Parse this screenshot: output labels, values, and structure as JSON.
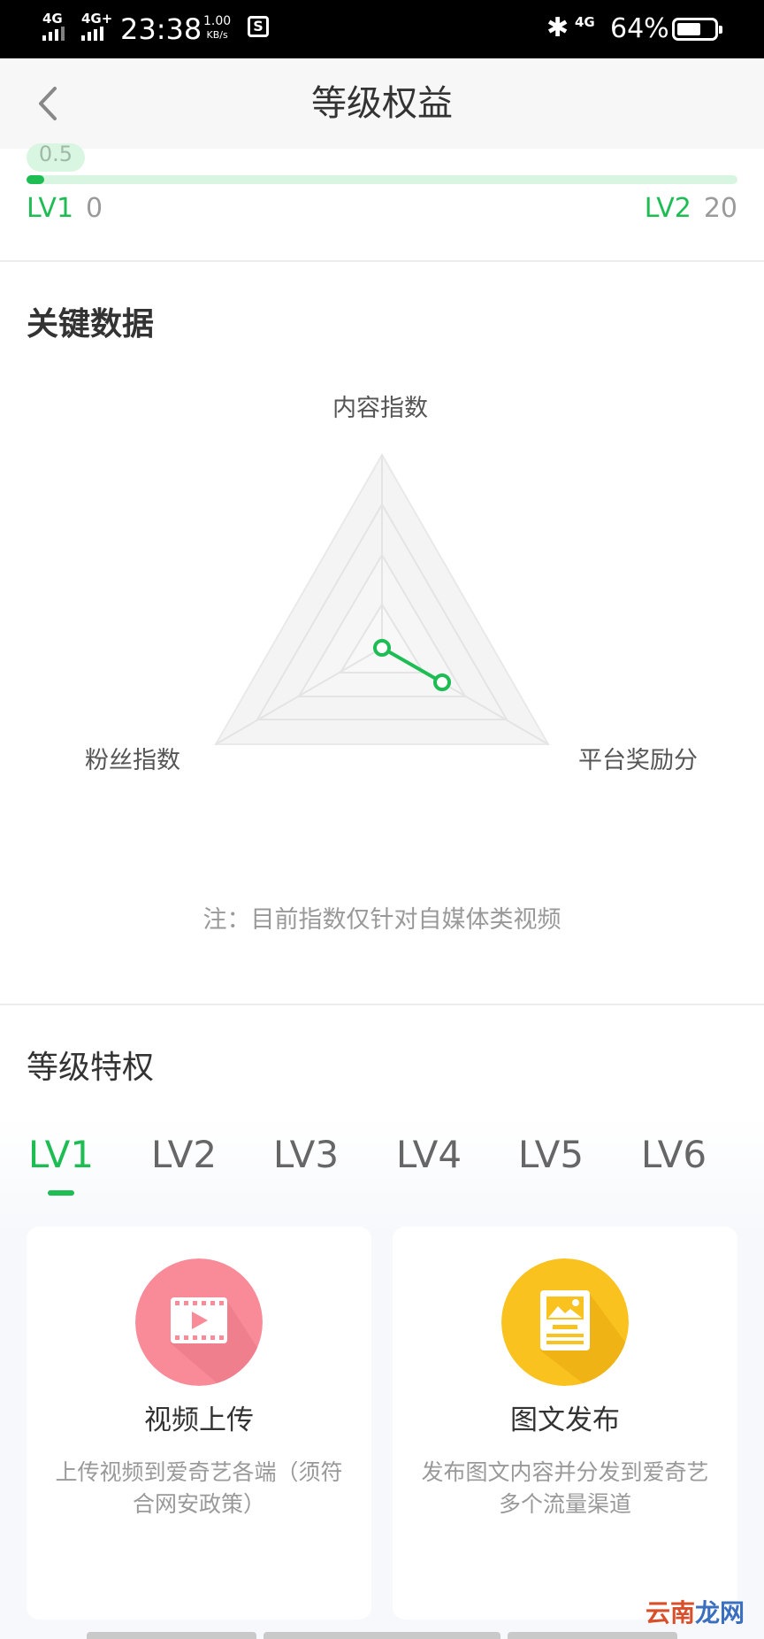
{
  "status_bar": {
    "network_1": "4G",
    "network_2": "4G+",
    "time": "23:38",
    "speed_value": "1.00",
    "speed_unit": "KB/s",
    "app_icon": "S",
    "bluetooth_icon": "bluetooth-icon",
    "network_3": "4G",
    "battery_percent": "64%",
    "battery_level": 0.64
  },
  "header": {
    "title": "等级权益",
    "back_icon": "chevron-left-icon"
  },
  "progress": {
    "bubble_value": "0.5",
    "current_level": "LV1",
    "current_value": "0",
    "next_level": "LV2",
    "next_value": "20",
    "fraction": 0.025,
    "colors": {
      "accent": "#1dbd54",
      "track": "#d7f5e0"
    }
  },
  "key_data": {
    "title": "关键数据",
    "radar_labels": {
      "top": "内容指数",
      "left": "粉丝指数",
      "right": "平台奖励分"
    },
    "note": "注：目前指数仅针对自媒体类视频"
  },
  "privileges": {
    "title": "等级特权",
    "tabs": [
      "LV1",
      "LV2",
      "LV3",
      "LV4",
      "LV5",
      "LV6"
    ],
    "active_tab": "LV1",
    "cards": [
      {
        "icon": "video-upload-icon",
        "title": "视频上传",
        "description": "上传视频到爱奇艺各端（须符合网安政策）",
        "color": "#f98b99"
      },
      {
        "icon": "article-publish-icon",
        "title": "图文发布",
        "description": "发布图文内容并分发到爱奇艺多个流量渠道",
        "color": "#f9c21f"
      }
    ]
  },
  "watermark": {
    "part1": "云南",
    "part2": "龙网"
  }
}
